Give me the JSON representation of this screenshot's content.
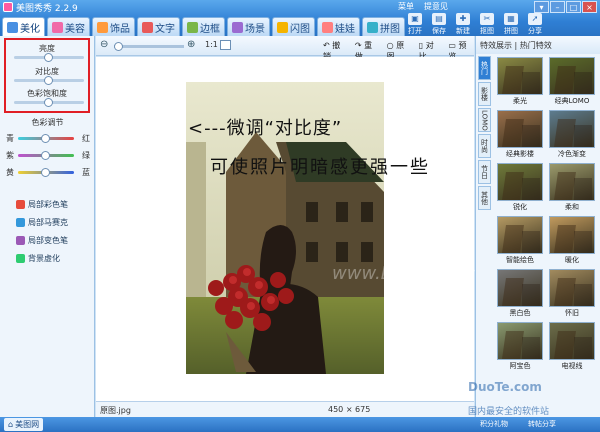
{
  "window": {
    "title": "美图秀秀 2.2.9",
    "top_menu": [
      "菜单",
      "提意见"
    ],
    "right_tools": [
      "打开",
      "保存",
      "新建",
      "抠图",
      "拼图",
      "分享"
    ]
  },
  "tabs": [
    {
      "label": "美化",
      "icon": "beautify-icon",
      "color": "#4a90e2"
    },
    {
      "label": "美容",
      "icon": "face-icon",
      "color": "#f06aa8"
    },
    {
      "label": "饰品",
      "icon": "accessory-icon",
      "color": "#ff9a3c"
    },
    {
      "label": "文字",
      "icon": "text-icon",
      "color": "#e85a5a"
    },
    {
      "label": "边框",
      "icon": "frame-icon",
      "color": "#7ab648"
    },
    {
      "label": "场景",
      "icon": "scene-icon",
      "color": "#9b6bd1"
    },
    {
      "label": "闪图",
      "icon": "flash-icon",
      "color": "#f5b400"
    },
    {
      "label": "娃娃",
      "icon": "doll-icon",
      "color": "#ff7f7f"
    },
    {
      "label": "拼图",
      "icon": "puzzle-icon",
      "color": "#36b0c9"
    }
  ],
  "left_panel": {
    "brightness_label": "亮度",
    "contrast_label": "对比度",
    "saturation_label": "色彩饱和度",
    "brightness_value": 0.5,
    "contrast_value": 0.5,
    "saturation_value": 0.5,
    "color_adjust_title": "色彩调节",
    "color_rows": [
      {
        "left": "青",
        "right": "红",
        "value": 0.5
      },
      {
        "left": "紫",
        "right": "绿",
        "value": 0.5
      },
      {
        "left": "黄",
        "right": "蓝",
        "value": 0.5
      }
    ],
    "tools": [
      {
        "label": "局部彩色笔",
        "color": "#e74c3c"
      },
      {
        "label": "局部马赛克",
        "color": "#3498db"
      },
      {
        "label": "局部变色笔",
        "color": "#9b59b6"
      },
      {
        "label": "背景虚化",
        "color": "#2ecc71"
      }
    ]
  },
  "toolbar": {
    "zoom_label": "1:1",
    "undo": "撤销",
    "redo": "重做",
    "original": "原图",
    "compare": "对比",
    "preview": "预览"
  },
  "annotation": {
    "line1": "<---微调“对比度”",
    "line2": "可使照片明暗感更强一些"
  },
  "status": {
    "filename": "原图.jpg",
    "dimensions": "450 × 675"
  },
  "right_panel": {
    "header": "特效展示 | 热门特效",
    "vertical_tabs": [
      "热门",
      "影楼",
      "LOMO",
      "时尚",
      "节日",
      "其他"
    ],
    "effects": [
      {
        "label": "柔光",
        "color": "#8a8a44"
      },
      {
        "label": "经典LOMO",
        "color": "#5b6b2a"
      },
      {
        "label": "经典影楼",
        "color": "#9a6f4b"
      },
      {
        "label": "冷色渐变",
        "color": "#5d7c8f"
      },
      {
        "label": "锐化",
        "color": "#6f7a3a"
      },
      {
        "label": "柔和",
        "color": "#9b9a6c"
      },
      {
        "label": "智能绘色",
        "color": "#b59a63"
      },
      {
        "label": "暖化",
        "color": "#c19a5e"
      },
      {
        "label": "黑白色",
        "color": "#777777"
      },
      {
        "label": "怀旧",
        "color": "#a28b5f"
      },
      {
        "label": "阿宝色",
        "color": "#8a9a70"
      },
      {
        "label": "电视线",
        "color": "#6c6d4a"
      }
    ]
  },
  "bottom": {
    "home": "美图网",
    "gift": "积分礼物",
    "share": "转帖分享"
  },
  "watermarks": {
    "site": "DuoTe.com",
    "slogan": "国内最安全的软件站",
    "canvas": "www.DuoTe.com"
  }
}
